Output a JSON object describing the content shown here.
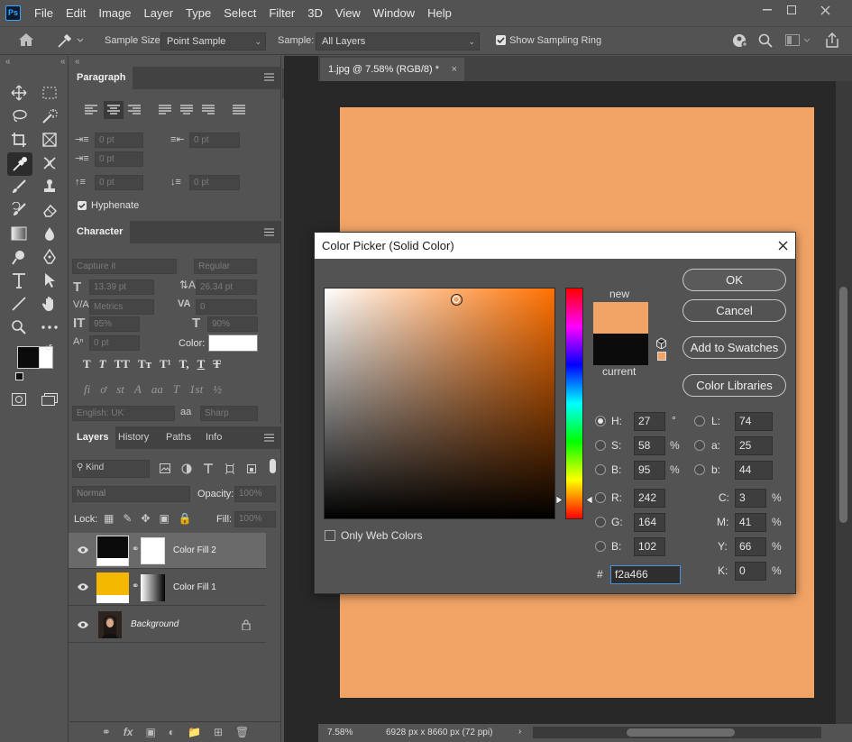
{
  "app": {
    "logo": "Ps"
  },
  "menu": [
    "File",
    "Edit",
    "Image",
    "Layer",
    "Type",
    "Select",
    "Filter",
    "3D",
    "View",
    "Window",
    "Help"
  ],
  "options": {
    "sample_size_label": "Sample Size:",
    "sample_size_value": "Point Sample",
    "sample_label": "Sample:",
    "sample_value": "All Layers",
    "show_ring_label": "Show Sampling Ring"
  },
  "paragraph": {
    "tab": "Paragraph",
    "indent_values": [
      "0 pt",
      "0 pt",
      "0 pt",
      "0 pt",
      "0 pt"
    ],
    "hyphenate": "Hyphenate"
  },
  "character": {
    "tab": "Character",
    "font_family": "Capture it",
    "font_style": "Regular",
    "size": "13.39 pt",
    "leading": "26.34 pt",
    "kerning": "Metrics",
    "tracking": "0",
    "vscale": "95%",
    "hscale": "90%",
    "baseline": "0 pt",
    "color_label": "Color:",
    "type_buttons": [
      "T",
      "T",
      "TT",
      "Tт",
      "T¹",
      "T,",
      "T",
      "T"
    ],
    "ot_buttons": [
      "fi",
      "ơ",
      "st",
      "A",
      "aa",
      "T",
      "1st",
      "½"
    ],
    "language": "English: UK",
    "aa_label": "aa",
    "aa_value": "Sharp"
  },
  "layers_panel": {
    "tabs": [
      "Layers",
      "History",
      "Paths",
      "Info"
    ],
    "filter_kind": "Kind",
    "blend": "Normal",
    "opacity_label": "Opacity:",
    "opacity_value": "100%",
    "lock_label": "Lock:",
    "fill_label": "Fill:",
    "fill_value": "100%",
    "layers": [
      {
        "name": "Color Fill 2",
        "swatch": "#0b0b0b"
      },
      {
        "name": "Color Fill 1",
        "swatch": "#f5b800"
      },
      {
        "name": "Background"
      }
    ]
  },
  "document": {
    "tab": "1.jpg @ 7.58% (RGB/8) *",
    "canvas_color": "#f2a466",
    "zoom": "7.58%",
    "doc_info": "6928 px x 8660 px (72 ppi)"
  },
  "color_picker": {
    "title": "Color Picker (Solid Color)",
    "new_label": "new",
    "current_label": "current",
    "new_color": "#f2a466",
    "current_color": "#0b0b0b",
    "buttons": {
      "ok": "OK",
      "cancel": "Cancel",
      "add": "Add to Swatches",
      "libraries": "Color Libraries"
    },
    "hsb": {
      "h": "27",
      "s": "58",
      "b": "95"
    },
    "rgb": {
      "r": "242",
      "g": "164",
      "b": "102"
    },
    "lab": {
      "l": "74",
      "a": "25",
      "b": "44"
    },
    "cmyk": {
      "c": "3",
      "m": "41",
      "y": "66",
      "k": "0"
    },
    "hex": "f2a466",
    "only_web": "Only Web Colors",
    "labels": {
      "H": "H:",
      "S": "S:",
      "B": "B:",
      "R": "R:",
      "G": "G:",
      "B2": "B:",
      "L": "L:",
      "a": "a:",
      "b": "b:",
      "C": "C:",
      "M": "M:",
      "Y": "Y:",
      "K": "K:",
      "hash": "#"
    },
    "units": {
      "deg": "°",
      "pct": "%"
    }
  }
}
